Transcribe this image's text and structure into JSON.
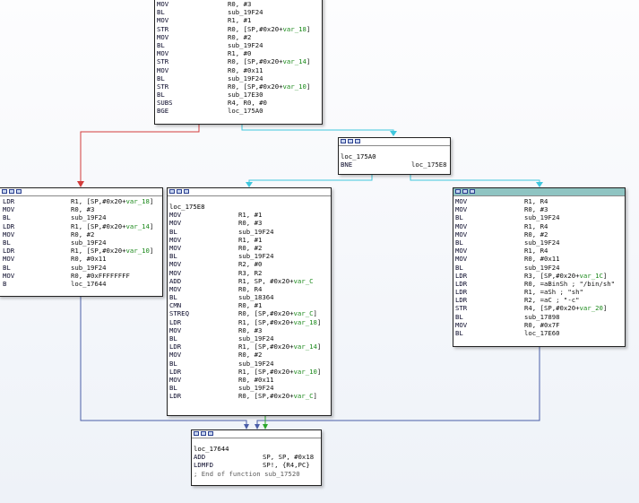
{
  "block_top": {
    "rows": [
      {
        "m": "MOV",
        "o": [
          {
            "t": "R0, #3"
          }
        ]
      },
      {
        "m": "BL",
        "o": [
          {
            "t": "sub_19F24"
          }
        ]
      },
      {
        "m": "MOV",
        "o": [
          {
            "t": "R1, #1"
          }
        ]
      },
      {
        "m": "STR",
        "o": [
          {
            "t": "R0, [SP,#0x20+"
          },
          {
            "t": "var_18",
            "g": true
          },
          {
            "t": "]"
          }
        ]
      },
      {
        "m": "MOV",
        "o": [
          {
            "t": "R0, #2"
          }
        ]
      },
      {
        "m": "BL",
        "o": [
          {
            "t": "sub_19F24"
          }
        ]
      },
      {
        "m": "MOV",
        "o": [
          {
            "t": "R1, #0"
          }
        ]
      },
      {
        "m": "STR",
        "o": [
          {
            "t": "R0, [SP,#0x20+"
          },
          {
            "t": "var_14",
            "g": true
          },
          {
            "t": "]"
          }
        ]
      },
      {
        "m": "MOV",
        "o": [
          {
            "t": "R0, #0x11"
          }
        ]
      },
      {
        "m": "BL",
        "o": [
          {
            "t": "sub_19F24"
          }
        ]
      },
      {
        "m": "STR",
        "o": [
          {
            "t": "R0, [SP,#0x20+"
          },
          {
            "t": "var_10",
            "g": true
          },
          {
            "t": "]"
          }
        ]
      },
      {
        "m": "BL",
        "o": [
          {
            "t": "sub_17E30"
          }
        ]
      },
      {
        "m": "SUBS",
        "o": [
          {
            "t": "R4, R0, #0"
          }
        ]
      },
      {
        "m": "BGE",
        "o": [
          {
            "t": "loc_175A0"
          }
        ]
      }
    ]
  },
  "block_loc_175a0": {
    "label": "loc_175A0",
    "rows": [
      {
        "m": "BNE",
        "o": [
          {
            "t": "loc_175E8"
          }
        ]
      }
    ]
  },
  "block_left": {
    "rows": [
      {
        "m": "LDR",
        "o": [
          {
            "t": "R1, [SP,#0x20+"
          },
          {
            "t": "var_18",
            "g": true
          },
          {
            "t": "]"
          }
        ]
      },
      {
        "m": "MOV",
        "o": [
          {
            "t": "R0, #3"
          }
        ]
      },
      {
        "m": "BL",
        "o": [
          {
            "t": "sub_19F24"
          }
        ]
      },
      {
        "m": "LDR",
        "o": [
          {
            "t": "R1, [SP,#0x20+"
          },
          {
            "t": "var_14",
            "g": true
          },
          {
            "t": "]"
          }
        ]
      },
      {
        "m": "MOV",
        "o": [
          {
            "t": "R0, #2"
          }
        ]
      },
      {
        "m": "BL",
        "o": [
          {
            "t": "sub_19F24"
          }
        ]
      },
      {
        "m": "LDR",
        "o": [
          {
            "t": "R1, [SP,#0x20+"
          },
          {
            "t": "var_10",
            "g": true
          },
          {
            "t": "]"
          }
        ]
      },
      {
        "m": "MOV",
        "o": [
          {
            "t": "R0, #0x11"
          }
        ]
      },
      {
        "m": "BL",
        "o": [
          {
            "t": "sub_19F24"
          }
        ]
      },
      {
        "m": "MOV",
        "o": [
          {
            "t": "R0, #0xFFFFFFFF"
          }
        ]
      },
      {
        "m": "B",
        "o": [
          {
            "t": "loc_17644"
          }
        ]
      }
    ]
  },
  "block_mid": {
    "label": "loc_175E8",
    "rows": [
      {
        "m": "MOV",
        "o": [
          {
            "t": "R1, #1"
          }
        ]
      },
      {
        "m": "MOV",
        "o": [
          {
            "t": "R0, #3"
          }
        ]
      },
      {
        "m": "BL",
        "o": [
          {
            "t": "sub_19F24"
          }
        ]
      },
      {
        "m": "MOV",
        "o": [
          {
            "t": "R1, #1"
          }
        ]
      },
      {
        "m": "MOV",
        "o": [
          {
            "t": "R0, #2"
          }
        ]
      },
      {
        "m": "BL",
        "o": [
          {
            "t": "sub_19F24"
          }
        ]
      },
      {
        "m": "MOV",
        "o": [
          {
            "t": "R2, #0"
          }
        ]
      },
      {
        "m": "MOV",
        "o": [
          {
            "t": "R3, R2"
          }
        ]
      },
      {
        "m": "ADD",
        "o": [
          {
            "t": "R1, SP, #0x20+"
          },
          {
            "t": "var_C",
            "g": true
          }
        ]
      },
      {
        "m": "MOV",
        "o": [
          {
            "t": "R0, R4"
          }
        ]
      },
      {
        "m": "BL",
        "o": [
          {
            "t": "sub_18364"
          }
        ]
      },
      {
        "m": "CMN",
        "o": [
          {
            "t": "R0, #1"
          }
        ]
      },
      {
        "m": "STREQ",
        "o": [
          {
            "t": "R0, [SP,#0x20+"
          },
          {
            "t": "var_C",
            "g": true
          },
          {
            "t": "]"
          }
        ]
      },
      {
        "m": "LDR",
        "o": [
          {
            "t": "R1, [SP,#0x20+"
          },
          {
            "t": "var_18",
            "g": true
          },
          {
            "t": "]"
          }
        ]
      },
      {
        "m": "MOV",
        "o": [
          {
            "t": "R0, #3"
          }
        ]
      },
      {
        "m": "BL",
        "o": [
          {
            "t": "sub_19F24"
          }
        ]
      },
      {
        "m": "LDR",
        "o": [
          {
            "t": "R1, [SP,#0x20+"
          },
          {
            "t": "var_14",
            "g": true
          },
          {
            "t": "]"
          }
        ]
      },
      {
        "m": "MOV",
        "o": [
          {
            "t": "R0, #2"
          }
        ]
      },
      {
        "m": "BL",
        "o": [
          {
            "t": "sub_19F24"
          }
        ]
      },
      {
        "m": "LDR",
        "o": [
          {
            "t": "R1, [SP,#0x20+"
          },
          {
            "t": "var_10",
            "g": true
          },
          {
            "t": "]"
          }
        ]
      },
      {
        "m": "MOV",
        "o": [
          {
            "t": "R0, #0x11"
          }
        ]
      },
      {
        "m": "BL",
        "o": [
          {
            "t": "sub_19F24"
          }
        ]
      },
      {
        "m": "LDR",
        "o": [
          {
            "t": "R0, [SP,#0x20+"
          },
          {
            "t": "var_C",
            "g": true
          },
          {
            "t": "]"
          }
        ]
      }
    ]
  },
  "block_right": {
    "rows": [
      {
        "m": "MOV",
        "o": [
          {
            "t": "R1, R4"
          }
        ]
      },
      {
        "m": "MOV",
        "o": [
          {
            "t": "R0, #3"
          }
        ]
      },
      {
        "m": "BL",
        "o": [
          {
            "t": "sub_19F24"
          }
        ]
      },
      {
        "m": "MOV",
        "o": [
          {
            "t": "R1, R4"
          }
        ]
      },
      {
        "m": "MOV",
        "o": [
          {
            "t": "R0, #2"
          }
        ]
      },
      {
        "m": "BL",
        "o": [
          {
            "t": "sub_19F24"
          }
        ]
      },
      {
        "m": "MOV",
        "o": [
          {
            "t": "R1, R4"
          }
        ]
      },
      {
        "m": "MOV",
        "o": [
          {
            "t": "R0, #0x11"
          }
        ]
      },
      {
        "m": "BL",
        "o": [
          {
            "t": "sub_19F24"
          }
        ]
      },
      {
        "m": "LDR",
        "o": [
          {
            "t": "R3, [SP,#0x20+"
          },
          {
            "t": "var_1C",
            "g": true
          },
          {
            "t": "]"
          }
        ]
      },
      {
        "m": "LDR",
        "o": [
          {
            "t": "R0, =aBinSh ; \"/bin/sh\""
          }
        ]
      },
      {
        "m": "LDR",
        "o": [
          {
            "t": "R1, =aSh ; \"sh\""
          }
        ]
      },
      {
        "m": "LDR",
        "o": [
          {
            "t": "R2, =aC ; \"-c\""
          }
        ]
      },
      {
        "m": "STR",
        "o": [
          {
            "t": "R4, [SP,#0x20+"
          },
          {
            "t": "var_20",
            "g": true
          },
          {
            "t": "]"
          }
        ]
      },
      {
        "m": "BL",
        "o": [
          {
            "t": "sub_17898"
          }
        ]
      },
      {
        "m": "MOV",
        "o": [
          {
            "t": "R0, #0x7F"
          }
        ]
      },
      {
        "m": "BL",
        "o": [
          {
            "t": "loc_17E60"
          }
        ]
      }
    ]
  },
  "block_end": {
    "label": "loc_17644",
    "rows": [
      {
        "m": "ADD",
        "o": [
          {
            "t": "SP, SP, #0x18"
          }
        ]
      },
      {
        "m": "LDMFD",
        "o": [
          {
            "t": "SP!, {R4,PC}"
          }
        ]
      }
    ],
    "comment": "; End of function sub_17520"
  },
  "colors": {
    "edge_false": "#d23c3c",
    "edge_true": "#3fc7dd",
    "edge_normal": "#4a5ea8",
    "edge_green": "#2aa82a",
    "operand_var": "#1c8a1c"
  }
}
